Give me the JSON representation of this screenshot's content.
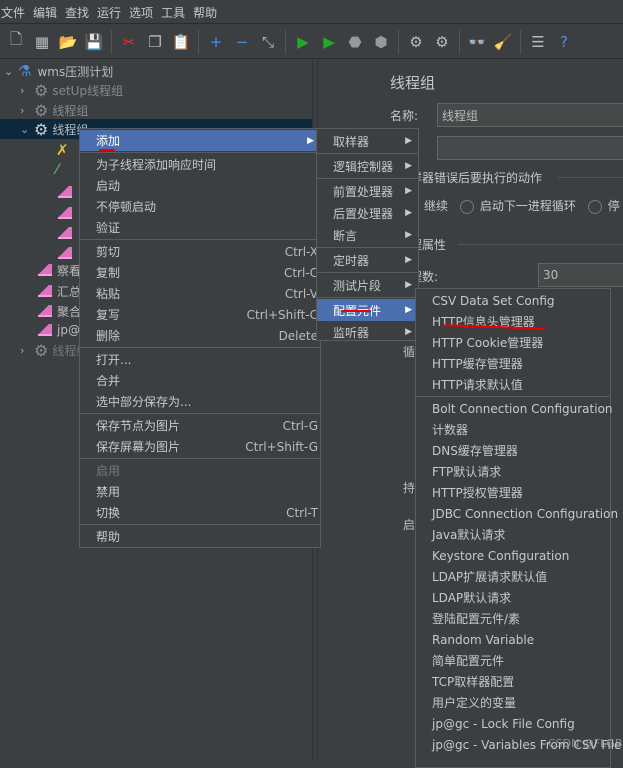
{
  "menubar": [
    "文件",
    "编辑",
    "查找",
    "运行",
    "选项",
    "工具",
    "帮助"
  ],
  "toolbar": [
    {
      "icon": "new-icon",
      "glyph": "🗋"
    },
    {
      "icon": "templates-icon",
      "glyph": "▦"
    },
    {
      "icon": "open-icon",
      "glyph": "📂"
    },
    {
      "icon": "save-icon",
      "glyph": "💾"
    },
    "sep",
    {
      "icon": "cut-icon",
      "glyph": "✂"
    },
    {
      "icon": "copy-icon",
      "glyph": "❐"
    },
    {
      "icon": "paste-icon",
      "glyph": "📋"
    },
    "sep",
    {
      "icon": "expand-icon",
      "glyph": "+"
    },
    {
      "icon": "collapse-icon",
      "glyph": "−"
    },
    {
      "icon": "toggle-icon",
      "glyph": "⤡"
    },
    "sep",
    {
      "icon": "start-icon",
      "glyph": "▶"
    },
    {
      "icon": "start-no-pause-icon",
      "glyph": "▶"
    },
    {
      "icon": "stop-icon",
      "glyph": "⬣"
    },
    {
      "icon": "shutdown-icon",
      "glyph": "⬢"
    },
    "sep",
    {
      "icon": "clear-icon",
      "glyph": "⚙"
    },
    {
      "icon": "clear-all-icon",
      "glyph": "⚙"
    },
    "sep",
    {
      "icon": "search-icon",
      "glyph": "👓"
    },
    {
      "icon": "reset-search-icon",
      "glyph": "🧹"
    },
    "sep",
    {
      "icon": "function-helper-icon",
      "glyph": "☰"
    },
    {
      "icon": "help-icon",
      "glyph": "?"
    }
  ],
  "tree": {
    "root": "wms压测计划",
    "setup": "setUp线程组",
    "group1": "线程组",
    "group2": "线程组",
    "group3": "线程组",
    "listeners": [
      "察看",
      "汇总",
      "聚合",
      "jp@"
    ]
  },
  "context_menu": {
    "items": [
      {
        "label": "添加",
        "sub": true,
        "selected": true
      },
      "sep",
      {
        "label": "为子线程添加响应时间"
      },
      {
        "label": "启动"
      },
      {
        "label": "不停顿启动"
      },
      {
        "label": "验证"
      },
      "sep",
      {
        "label": "剪切",
        "shortcut": "Ctrl-X"
      },
      {
        "label": "复制",
        "shortcut": "Ctrl-C"
      },
      {
        "label": "粘贴",
        "shortcut": "Ctrl-V"
      },
      {
        "label": "复写",
        "shortcut": "Ctrl+Shift-C"
      },
      {
        "label": "删除",
        "shortcut": "Delete"
      },
      "sep",
      {
        "label": "打开..."
      },
      {
        "label": "合并"
      },
      {
        "label": "选中部分保存为..."
      },
      "sep",
      {
        "label": "保存节点为图片",
        "shortcut": "Ctrl-G"
      },
      {
        "label": "保存屏幕为图片",
        "shortcut": "Ctrl+Shift-G"
      },
      "sep",
      {
        "label": "启用",
        "disabled": true
      },
      {
        "label": "禁用"
      },
      {
        "label": "切换",
        "shortcut": "Ctrl-T"
      },
      "sep",
      {
        "label": "帮助"
      }
    ]
  },
  "add_submenu": {
    "items": [
      {
        "label": "取样器",
        "sub": true
      },
      "sep",
      {
        "label": "逻辑控制器",
        "sub": true
      },
      "sep",
      {
        "label": "前置处理器",
        "sub": true
      },
      {
        "label": "后置处理器",
        "sub": true
      },
      {
        "label": "断言",
        "sub": true
      },
      "sep",
      {
        "label": "定时器",
        "sub": true
      },
      "sep",
      {
        "label": "测试片段",
        "sub": true
      },
      "sep",
      {
        "label": "配置元件",
        "sub": true,
        "selected": true
      },
      {
        "label": "监听器",
        "sub": true
      }
    ]
  },
  "config_submenu": {
    "items": [
      {
        "label": "CSV Data Set Config"
      },
      {
        "label": "HTTP信息头管理器"
      },
      {
        "label": "HTTP Cookie管理器"
      },
      {
        "label": "HTTP缓存管理器"
      },
      {
        "label": "HTTP请求默认值"
      },
      "sep",
      {
        "label": "Bolt Connection Configuration"
      },
      {
        "label": "计数器"
      },
      {
        "label": "DNS缓存管理器"
      },
      {
        "label": "FTP默认请求"
      },
      {
        "label": "HTTP授权管理器"
      },
      {
        "label": "JDBC Connection Configuration"
      },
      {
        "label": "Java默认请求"
      },
      {
        "label": "Keystore Configuration"
      },
      {
        "label": "LDAP扩展请求默认值"
      },
      {
        "label": "LDAP默认请求"
      },
      {
        "label": "登陆配置元件/素"
      },
      {
        "label": "Random Variable"
      },
      {
        "label": "简单配置元件"
      },
      {
        "label": "TCP取样器配置"
      },
      {
        "label": "用户定义的变量"
      },
      {
        "label": "jp@gc - Lock File Config"
      },
      {
        "label": "jp@gc - Variables From CSV File"
      }
    ]
  },
  "panel": {
    "title": "线程组",
    "name_label": "名称:",
    "name_value": "线程组",
    "comment_value": "",
    "error_action_label": "取样器错误后要执行的动作",
    "radio_continue": "继续",
    "radio_next_loop": "启动下一进程循环",
    "radio_partial": "停",
    "thread_props_label": "线程属性",
    "threads_label": "线程数:",
    "threads_value": "30",
    "loop_partial": "循",
    "duration_partial": "持",
    "start_partial": "启"
  },
  "watermark": "CSDN @FLGB",
  "colors": {
    "selection": "#4b6eaf",
    "background": "#3c3f41",
    "annotation": "#ee0000"
  }
}
